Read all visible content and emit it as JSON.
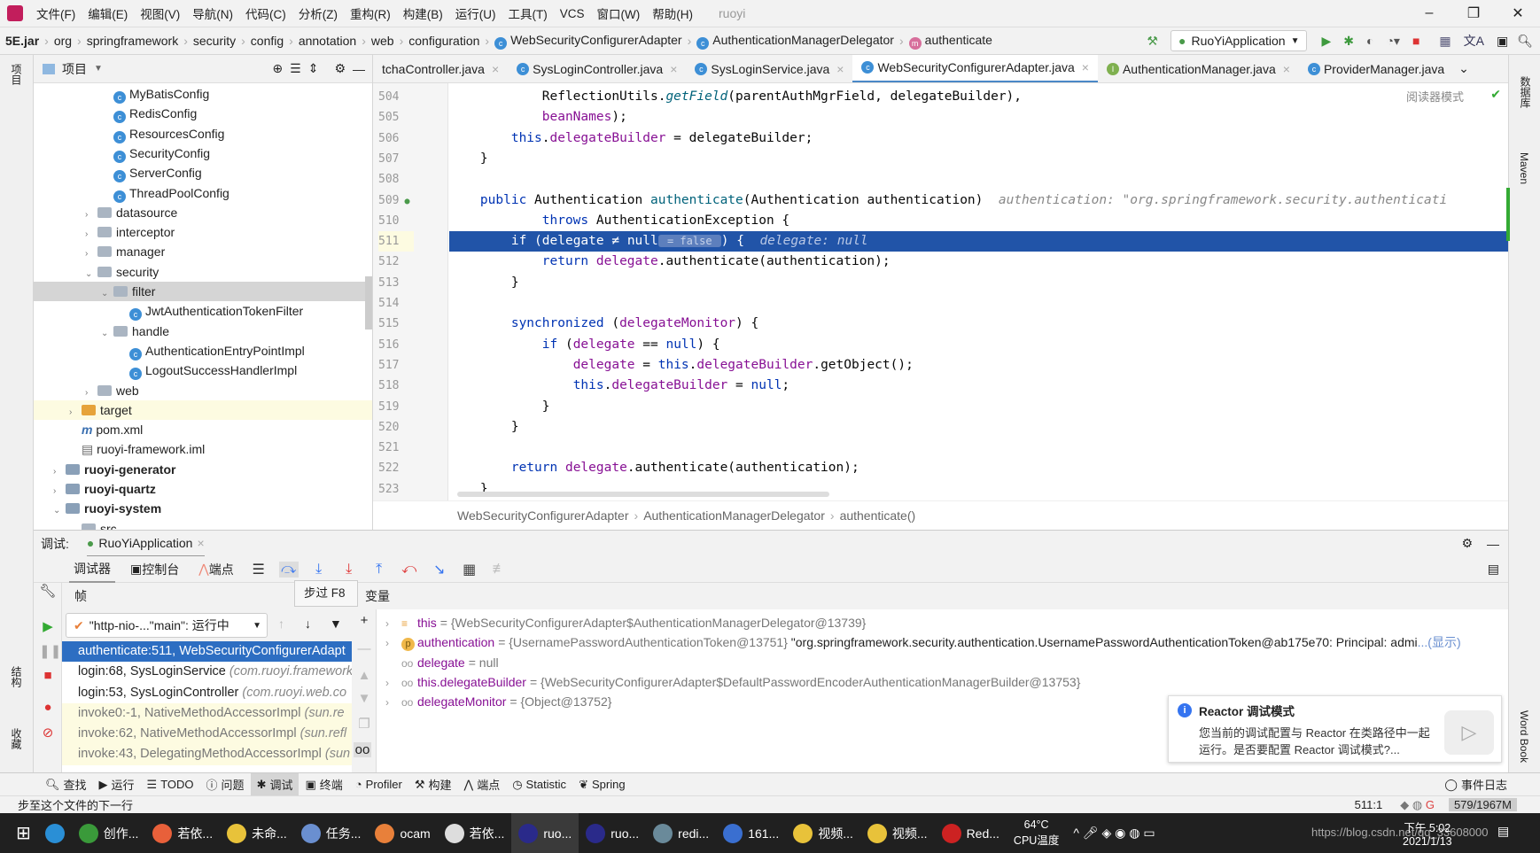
{
  "menu": {
    "items": [
      "文件(F)",
      "编辑(E)",
      "视图(V)",
      "导航(N)",
      "代码(C)",
      "分析(Z)",
      "重构(R)",
      "构建(B)",
      "运行(U)",
      "工具(T)",
      "VCS",
      "窗口(W)",
      "帮助(H)"
    ],
    "project_title": "ruoyi"
  },
  "nav": {
    "crumbs": [
      "5E.jar",
      "org",
      "springframework",
      "security",
      "config",
      "annotation",
      "web",
      "configuration",
      "WebSecurityConfigurerAdapter",
      "AuthenticationManagerDelegator",
      "authenticate"
    ],
    "run_config": "RuoYiApplication"
  },
  "project": {
    "title": "项目",
    "tree": [
      {
        "label": "MyBatisConfig",
        "type": "class",
        "indent": 3
      },
      {
        "label": "RedisConfig",
        "type": "class",
        "indent": 3
      },
      {
        "label": "ResourcesConfig",
        "type": "class",
        "indent": 3
      },
      {
        "label": "SecurityConfig",
        "type": "class",
        "indent": 3
      },
      {
        "label": "ServerConfig",
        "type": "class",
        "indent": 3
      },
      {
        "label": "ThreadPoolConfig",
        "type": "class",
        "indent": 3
      },
      {
        "label": "datasource",
        "type": "folder",
        "indent": 2,
        "state": "collapsed"
      },
      {
        "label": "interceptor",
        "type": "folder",
        "indent": 2,
        "state": "collapsed"
      },
      {
        "label": "manager",
        "type": "folder",
        "indent": 2,
        "state": "collapsed"
      },
      {
        "label": "security",
        "type": "folder",
        "indent": 2,
        "state": "expanded"
      },
      {
        "label": "filter",
        "type": "folder",
        "indent": 3,
        "state": "expanded",
        "selected": true
      },
      {
        "label": "JwtAuthenticationTokenFilter",
        "type": "class",
        "indent": 4
      },
      {
        "label": "handle",
        "type": "folder",
        "indent": 3,
        "state": "expanded"
      },
      {
        "label": "AuthenticationEntryPointImpl",
        "type": "class",
        "indent": 4
      },
      {
        "label": "LogoutSuccessHandlerImpl",
        "type": "class",
        "indent": 4
      },
      {
        "label": "web",
        "type": "folder",
        "indent": 2,
        "state": "collapsed"
      },
      {
        "label": "target",
        "type": "folder-orange",
        "indent": 1,
        "state": "collapsed",
        "highlight": true
      },
      {
        "label": "pom.xml",
        "type": "maven",
        "indent": 1
      },
      {
        "label": "ruoyi-framework.iml",
        "type": "file",
        "indent": 1
      },
      {
        "label": "ruoyi-generator",
        "type": "module",
        "indent": 0,
        "state": "collapsed",
        "bold": true
      },
      {
        "label": "ruoyi-quartz",
        "type": "module",
        "indent": 0,
        "state": "collapsed",
        "bold": true
      },
      {
        "label": "ruoyi-system",
        "type": "module",
        "indent": 0,
        "state": "expanded",
        "bold": true
      },
      {
        "label": "src",
        "type": "folder",
        "indent": 1,
        "state": "expanded"
      }
    ]
  },
  "tabs": [
    {
      "label": "tchaController.java",
      "icon": "c"
    },
    {
      "label": "SysLoginController.java",
      "icon": "c"
    },
    {
      "label": "SysLoginService.java",
      "icon": "c"
    },
    {
      "label": "WebSecurityConfigurerAdapter.java",
      "icon": "c",
      "active": true
    },
    {
      "label": "AuthenticationManager.java",
      "icon": "i"
    },
    {
      "label": "ProviderManager.java",
      "icon": "c"
    }
  ],
  "editor": {
    "reader_mode": "阅读器模式",
    "current_line": 511,
    "lines": [
      {
        "n": "504",
        "html": "            ReflectionUtils.<span class='fn it'>getField</span>(parentAuthMgrField, delegateBuilder),"
      },
      {
        "n": "505",
        "html": "            <span class='fld'>beanNames</span>);"
      },
      {
        "n": "506",
        "html": "        <span class='kw'>this</span>.<span class='fld'>delegateBuilder</span> = delegateBuilder;"
      },
      {
        "n": "507",
        "html": "    }"
      },
      {
        "n": "508",
        "html": ""
      },
      {
        "n": "509",
        "html": "    <span class='kw'>public</span> Authentication <span class='fn'>authenticate</span>(Authentication authentication)  <span class='hint'>authentication: \"org.springframework.security.authenticati</span>"
      },
      {
        "n": "510",
        "html": "            <span class='kw'>throws</span> AuthenticationException {"
      },
      {
        "n": "511",
        "html": "        <span class='kw'>if</span> (<span class='fld'>delegate</span> ≠ <span class='kw'>null</span><span class='inl'> = false </span>) {  <span class='hint'>delegate: null</span>"
      },
      {
        "n": "512",
        "html": "            <span class='kw'>return</span> <span class='fld'>delegate</span>.authenticate(authentication);"
      },
      {
        "n": "513",
        "html": "        }"
      },
      {
        "n": "514",
        "html": ""
      },
      {
        "n": "515",
        "html": "        <span class='kw'>synchronized</span> (<span class='fld'>delegateMonitor</span>) {"
      },
      {
        "n": "516",
        "html": "            <span class='kw'>if</span> (<span class='fld'>delegate</span> == <span class='kw'>null</span>) {"
      },
      {
        "n": "517",
        "html": "                <span class='fld'>delegate</span> = <span class='kw'>this</span>.<span class='fld'>delegateBuilder</span>.getObject();"
      },
      {
        "n": "518",
        "html": "                <span class='kw'>this</span>.<span class='fld'>delegateBuilder</span> = <span class='kw'>null</span>;"
      },
      {
        "n": "519",
        "html": "            }"
      },
      {
        "n": "520",
        "html": "        }"
      },
      {
        "n": "521",
        "html": ""
      },
      {
        "n": "522",
        "html": "        <span class='kw'>return</span> <span class='fld'>delegate</span>.authenticate(authentication);"
      },
      {
        "n": "523",
        "html": "    }"
      }
    ],
    "breadcrumb": [
      "WebSecurityConfigurerAdapter",
      "AuthenticationManagerDelegator",
      "authenticate()"
    ]
  },
  "debug": {
    "label": "调试:",
    "session": "RuoYiApplication",
    "tabs": {
      "debugger": "调试器",
      "console": "控制台",
      "breakpoints": "端点"
    },
    "tooltip": "步过  F8",
    "frames_header": "帧",
    "vars_header": "变量",
    "thread": "\"http-nio-...\"main\": 运行中",
    "frames": [
      {
        "method": "authenticate:511, WebSecurityConfigurerAdapt",
        "pkg": "",
        "kind": "sel"
      },
      {
        "method": "login:68, SysLoginService ",
        "pkg": "(com.ruoyi.framework",
        "kind": ""
      },
      {
        "method": "login:53, SysLoginController ",
        "pkg": "(com.ruoyi.web.co",
        "kind": ""
      },
      {
        "method": "invoke0:-1, NativeMethodAccessorImpl ",
        "pkg": "(sun.re",
        "kind": "lib"
      },
      {
        "method": "invoke:62, NativeMethodAccessorImpl ",
        "pkg": "(sun.refl",
        "kind": "lib"
      },
      {
        "method": "invoke:43, DelegatingMethodAccessorImpl ",
        "pkg": "(sun",
        "kind": "lib"
      }
    ],
    "variables": [
      {
        "name": "this",
        "value": "= {WebSecurityConfigurerAdapter$AuthenticationManagerDelegator@13739}",
        "extra": "",
        "icon": "≡",
        "expand": true
      },
      {
        "name": "authentication",
        "value": "= {UsernamePasswordAuthenticationToken@13751} ",
        "extra": "\"org.springframework.security.authentication.UsernamePasswordAuthenticationToken@ab175e70: Principal: admi",
        "link": "...(显示)",
        "icon": "p",
        "expand": true
      },
      {
        "name": "delegate",
        "value": "= null",
        "extra": "",
        "icon": "oo",
        "expand": false
      },
      {
        "name": "this.delegateBuilder",
        "value": "= {WebSecurityConfigurerAdapter$DefaultPasswordEncoderAuthenticationManagerBuilder@13753}",
        "extra": "",
        "icon": "oo",
        "expand": true
      },
      {
        "name": "delegateMonitor",
        "value": "= {Object@13752}",
        "extra": "",
        "icon": "oo",
        "expand": true
      }
    ]
  },
  "notification": {
    "title": "Reactor 调试模式",
    "body": "您当前的调试配置与 Reactor 在类路径中一起运行。是否要配置 Reactor 调试模式?..."
  },
  "bottom_tools": [
    "查找",
    "运行",
    "TODO",
    "问题",
    "调试",
    "终端",
    "Profiler",
    "构建",
    "端点",
    "Statistic",
    "Spring"
  ],
  "bottom_active": "调试",
  "event_log": "事件日志",
  "status": {
    "message": "步至这个文件的下一行",
    "position": "511:1",
    "memory": "579/1967M"
  },
  "right_strip": [
    "数据库",
    "Maven",
    "Word Book"
  ],
  "left_strip": [
    "项目",
    "结构",
    "收藏"
  ],
  "taskbar": {
    "apps": [
      "创作...",
      "若依...",
      "未命...",
      "任务...",
      "ocam",
      "若依...",
      "ruo...",
      "ruo...",
      "redi...",
      "161...",
      "视频...",
      "视频...",
      "Red..."
    ],
    "active_index": 6,
    "temp": "64°C",
    "temp_label": "CPU温度",
    "time": "下午 5:02",
    "date": "2021/1/13",
    "watermark": "https://blog.csdn.net/qq_33608000"
  },
  "colors": {
    "selection": "#2154a8",
    "frame_selected": "#2d6ec2",
    "keyword": "#0033b3",
    "field": "#871094",
    "accent": "#3574f0"
  }
}
